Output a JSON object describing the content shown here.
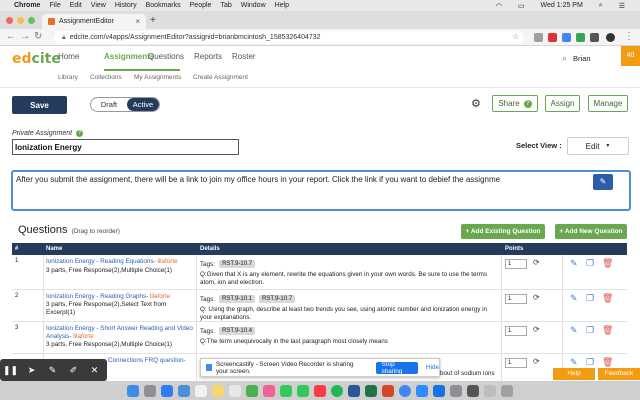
{
  "menubar": {
    "app": "Chrome",
    "items": [
      "File",
      "Edit",
      "View",
      "History",
      "Bookmarks",
      "People",
      "Tab",
      "Window",
      "Help"
    ],
    "clock": "Wed 1:25 PM"
  },
  "browser": {
    "tab_title": "AssignmentEditor",
    "url": "edcite.com/v4apps/AssignmentEditor?assignid=brianbmcintosh_1585326404732"
  },
  "app": {
    "logo_ed": "ed",
    "logo_cite": "cite",
    "nav": [
      "Home",
      "Assignments",
      "Questions",
      "Reports",
      "Roster"
    ],
    "subnav": [
      "Library",
      "Collections",
      "My Assignments",
      "Create Assignment"
    ],
    "user_name": "Brian",
    "notifications": "40"
  },
  "toolbar": {
    "save_label": "Save",
    "draft_label": "Draft",
    "active_label": "Active",
    "share_label": "Share",
    "assign_label": "Assign",
    "manage_label": "Manage"
  },
  "assignment": {
    "private_label": "Private Assignment",
    "name": "Ionization Energy",
    "select_view_label": "Select View :",
    "view_value": "Edit",
    "instructions": "After you submit the assignment, there will be a link to join my office hours in your report. Click the link if you want to debief the assignme"
  },
  "questions": {
    "title": "Questions",
    "drag_hint": "(Drag to reorder)",
    "add_existing_label": "+ Add Existing Question",
    "add_new_label": "+ Add New Question",
    "headers": {
      "num": "#",
      "name": "Name",
      "details": "Details",
      "points": "Points"
    },
    "tags_label": "Tags:",
    "rows": [
      {
        "num": "1",
        "name": "Ionization Energy - Reading Equations-",
        "author": "lilaforte",
        "desc": "3 parts, Free Response(2),Multiple Choice(1)",
        "tags": [
          "RST.9-10.7"
        ],
        "text": "Q:Given that X is any element, rewrite the equations given in your own words. Be sure to use the terms atom, ion and electron.",
        "points": "1"
      },
      {
        "num": "2",
        "name": "Ionization Energy - Reading Graphs-",
        "author": "lilaforte",
        "desc": "3 parts, Free Response(2),Select Text from Excerpt(1)",
        "tags": [
          "RST.9-10.1",
          "RST.9-10.7"
        ],
        "text": "Q: Using the graph, describe at least two trends you see, using atomic number and ionization energy in your explanations.",
        "points": "1"
      },
      {
        "num": "3",
        "name": "Ionization Energy - Short Answer Reading and Video Analysis-",
        "author": "lilaforte",
        "desc": "3 parts, Free Response(2),Multiple Choice(1)",
        "tags": [
          "RST.9-10.4"
        ],
        "text": "Q:The term unequivocally in the last paragraph most closely means",
        "points": "1"
      },
      {
        "num": "4",
        "name": "Connections FRQ question-",
        "author": "",
        "desc": "",
        "tags": [],
        "text": "bout of sodium ions",
        "points": "1"
      }
    ]
  },
  "overlay": {
    "share_message": "Screencastify - Screen Video Recorder is sharing your screen.",
    "stop_label": "Stop sharing",
    "hide_label": "Hide",
    "help_label": "Help",
    "feedback_label": "Feedback"
  },
  "colors": {
    "navy": "#243b5e",
    "green": "#6aa84f",
    "orange": "#f39c12",
    "link_blue": "#2a62b5"
  }
}
